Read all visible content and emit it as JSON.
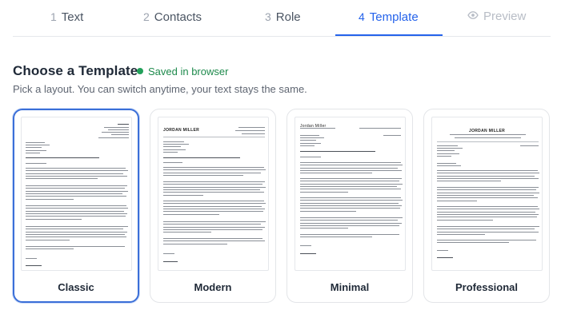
{
  "steps": [
    {
      "num": "1",
      "label": "Text",
      "state": "default"
    },
    {
      "num": "2",
      "label": "Contacts",
      "state": "default"
    },
    {
      "num": "3",
      "label": "Role",
      "state": "default"
    },
    {
      "num": "4",
      "label": "Template",
      "state": "active"
    },
    {
      "icon": "eye-icon",
      "label": "Preview",
      "state": "disabled"
    }
  ],
  "heading": {
    "title": "Choose a Template",
    "saved_status": "Saved in browser",
    "subtitle": "Pick a layout. You can switch anytime, your text stays the same."
  },
  "templates": [
    {
      "name": "Classic",
      "selected": true
    },
    {
      "name": "Modern",
      "selected": false,
      "header_name": "JORDAN MILLER"
    },
    {
      "name": "Minimal",
      "selected": false,
      "header_name": "Jordan Miller"
    },
    {
      "name": "Professional",
      "selected": false,
      "header_name": "JORDAN MILLER"
    }
  ],
  "colors": {
    "accent": "#2563eb",
    "saved_green": "#22a05a",
    "selected_border": "#3b6fd8"
  }
}
